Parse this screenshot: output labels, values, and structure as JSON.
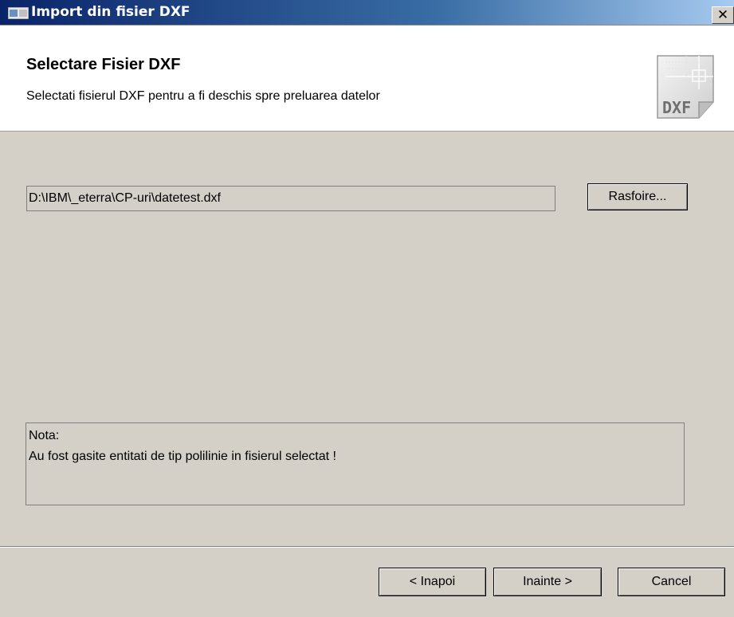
{
  "window": {
    "title": "Import din fisier DXF",
    "close_label": "✕"
  },
  "header": {
    "title": "Selectare Fisier DXF",
    "subtitle": "Selectati fisierul DXF pentru a fi deschis spre preluarea datelor",
    "icon_name": "dxf-file-icon",
    "icon_text": "DXF"
  },
  "file": {
    "path": "D:\\IBM\\_eterra\\CP-uri\\datetest.dxf",
    "browse_label": "Rasfoire..."
  },
  "note": {
    "label": "Nota:",
    "text": "Au fost gasite entitati de tip polilinie in fisierul selectat !"
  },
  "footer": {
    "back_label": "< Inapoi",
    "next_label": "Inainte >",
    "cancel_label": "Cancel"
  },
  "colors": {
    "dialog_bg": "#d4d0c8",
    "titlebar_start": "#0a246a",
    "titlebar_end": "#a6caf0"
  }
}
